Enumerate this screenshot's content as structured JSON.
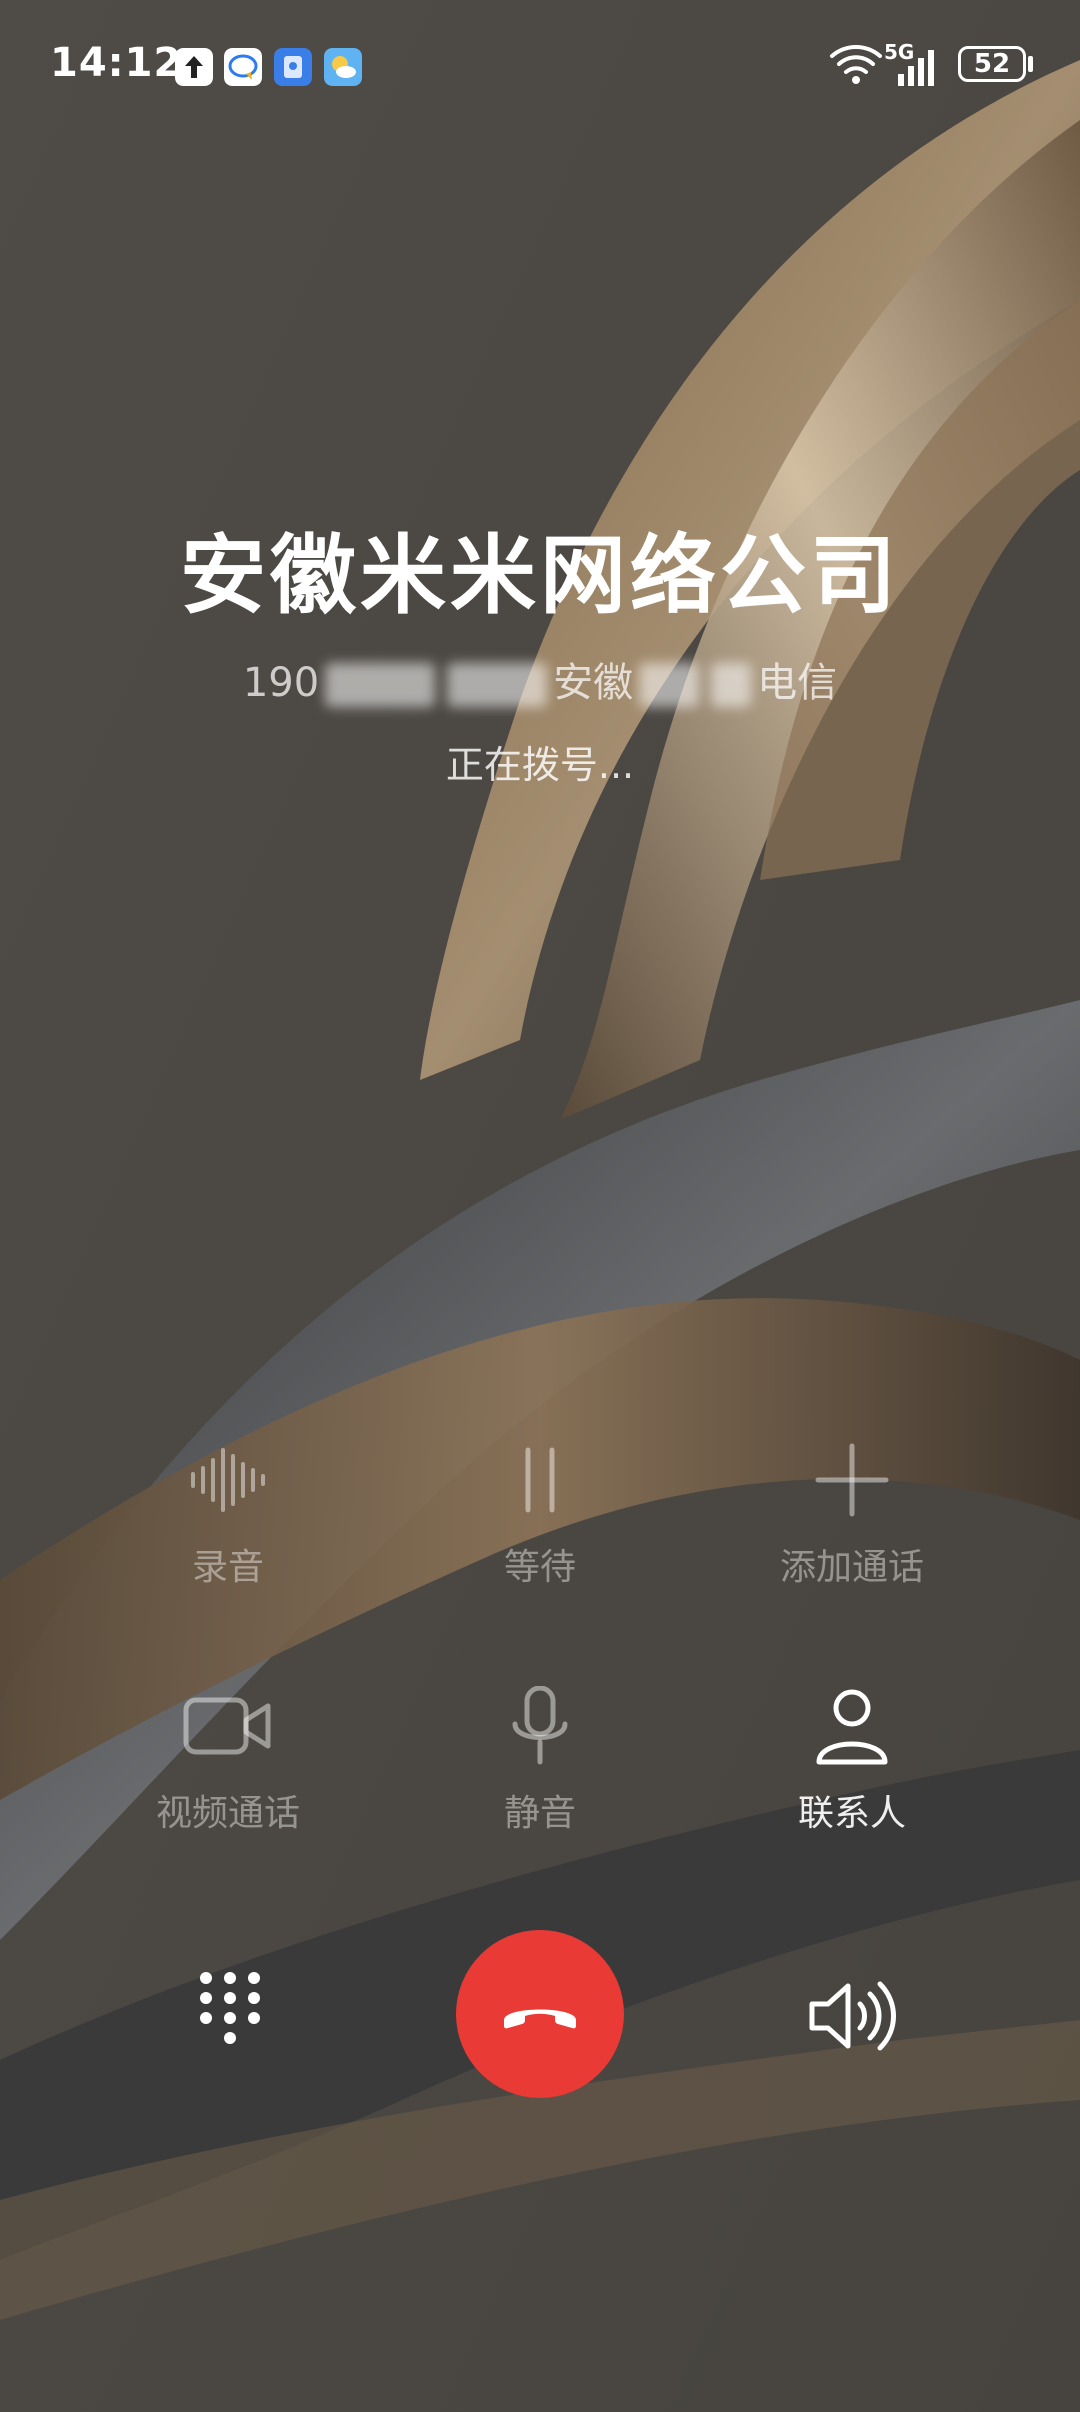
{
  "status_bar": {
    "time": "14:12",
    "network": "5G",
    "battery": "52",
    "notification_icons": [
      "upload-icon",
      "chat-icon",
      "security-icon",
      "weather-icon"
    ]
  },
  "caller": {
    "name": "安徽米米网络公司",
    "number_prefix": "190",
    "region": "安徽",
    "carrier": "电信",
    "status": "正在拨号..."
  },
  "controls": [
    {
      "label": "录音",
      "icon": "record-icon",
      "enabled": false
    },
    {
      "label": "等待",
      "icon": "hold-icon",
      "enabled": false
    },
    {
      "label": "添加通话",
      "icon": "add-call-icon",
      "enabled": false
    },
    {
      "label": "视频通话",
      "icon": "video-call-icon",
      "enabled": false
    },
    {
      "label": "静音",
      "icon": "mute-icon",
      "enabled": false
    },
    {
      "label": "联系人",
      "icon": "contacts-icon",
      "enabled": true
    }
  ],
  "bottom": {
    "dialpad_icon": "dialpad-icon",
    "hangup_icon": "hang-up-icon",
    "speaker_icon": "speaker-icon",
    "hangup_color": "#ea3a36"
  }
}
